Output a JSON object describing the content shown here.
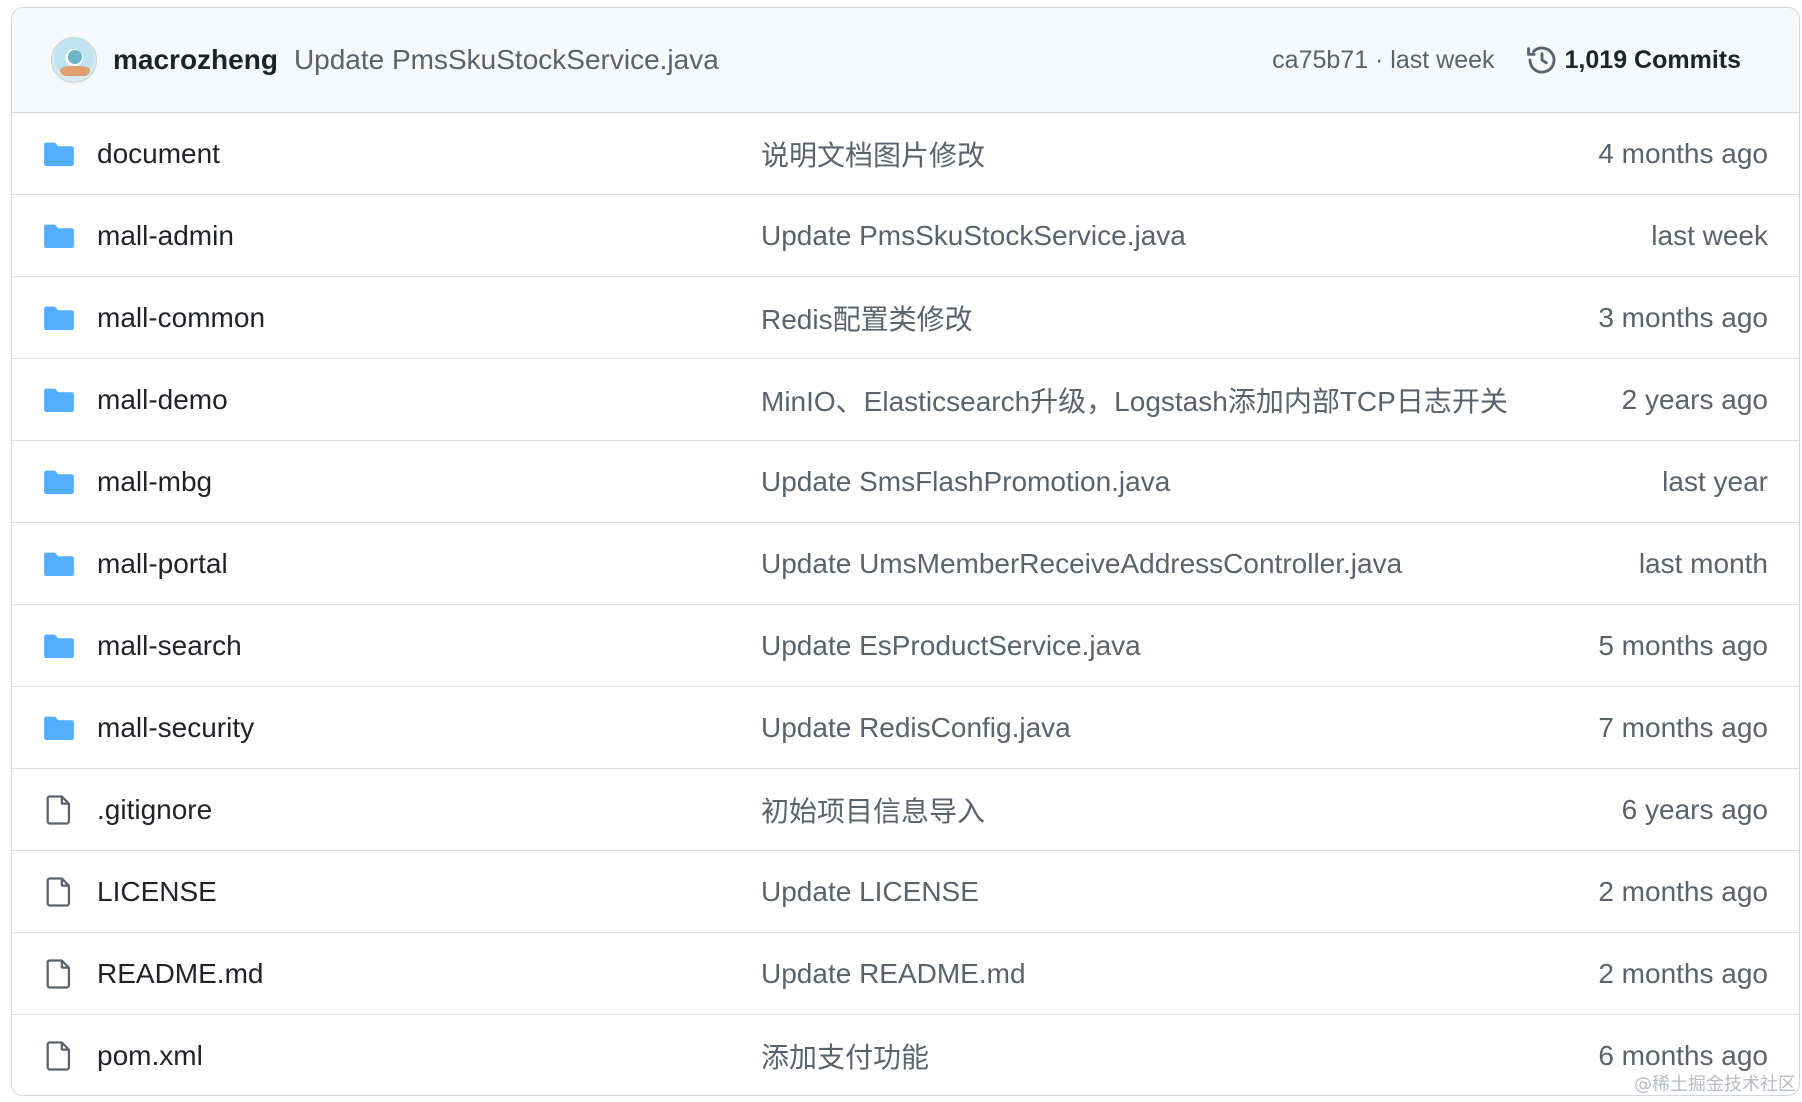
{
  "header": {
    "author": "macrozheng",
    "commit_message": "Update PmsSkuStockService.java",
    "commit_meta": "ca75b71 · last week",
    "commits_count": "1,019 Commits"
  },
  "rows": [
    {
      "type": "folder",
      "name": "document",
      "message": "说明文档图片修改",
      "time": "4 months ago"
    },
    {
      "type": "folder",
      "name": "mall-admin",
      "message": "Update PmsSkuStockService.java",
      "time": "last week"
    },
    {
      "type": "folder",
      "name": "mall-common",
      "message": "Redis配置类修改",
      "time": "3 months ago"
    },
    {
      "type": "folder",
      "name": "mall-demo",
      "message": "MinIO、Elasticsearch升级，Logstash添加内部TCP日志开关",
      "time": "2 years ago"
    },
    {
      "type": "folder",
      "name": "mall-mbg",
      "message": "Update SmsFlashPromotion.java",
      "time": "last year"
    },
    {
      "type": "folder",
      "name": "mall-portal",
      "message": "Update UmsMemberReceiveAddressController.java",
      "time": "last month"
    },
    {
      "type": "folder",
      "name": "mall-search",
      "message": "Update EsProductService.java",
      "time": "5 months ago"
    },
    {
      "type": "folder",
      "name": "mall-security",
      "message": "Update RedisConfig.java",
      "time": "7 months ago"
    },
    {
      "type": "file",
      "name": ".gitignore",
      "message": "初始项目信息导入",
      "time": "6 years ago"
    },
    {
      "type": "file",
      "name": "LICENSE",
      "message": "Update LICENSE",
      "time": "2 months ago"
    },
    {
      "type": "file",
      "name": "README.md",
      "message": "Update README.md",
      "time": "2 months ago"
    },
    {
      "type": "file",
      "name": "pom.xml",
      "message": "添加支付功能",
      "time": "6 months ago"
    }
  ],
  "icons": {
    "folder": "folder-icon",
    "file": "file-icon",
    "history": "history-icon"
  },
  "colors": {
    "folder": "#54aeff",
    "file_outline": "#59636e",
    "header_bg": "#f6f8fa",
    "border": "#d0d7de"
  },
  "watermark": "@稀土掘金技术社区"
}
